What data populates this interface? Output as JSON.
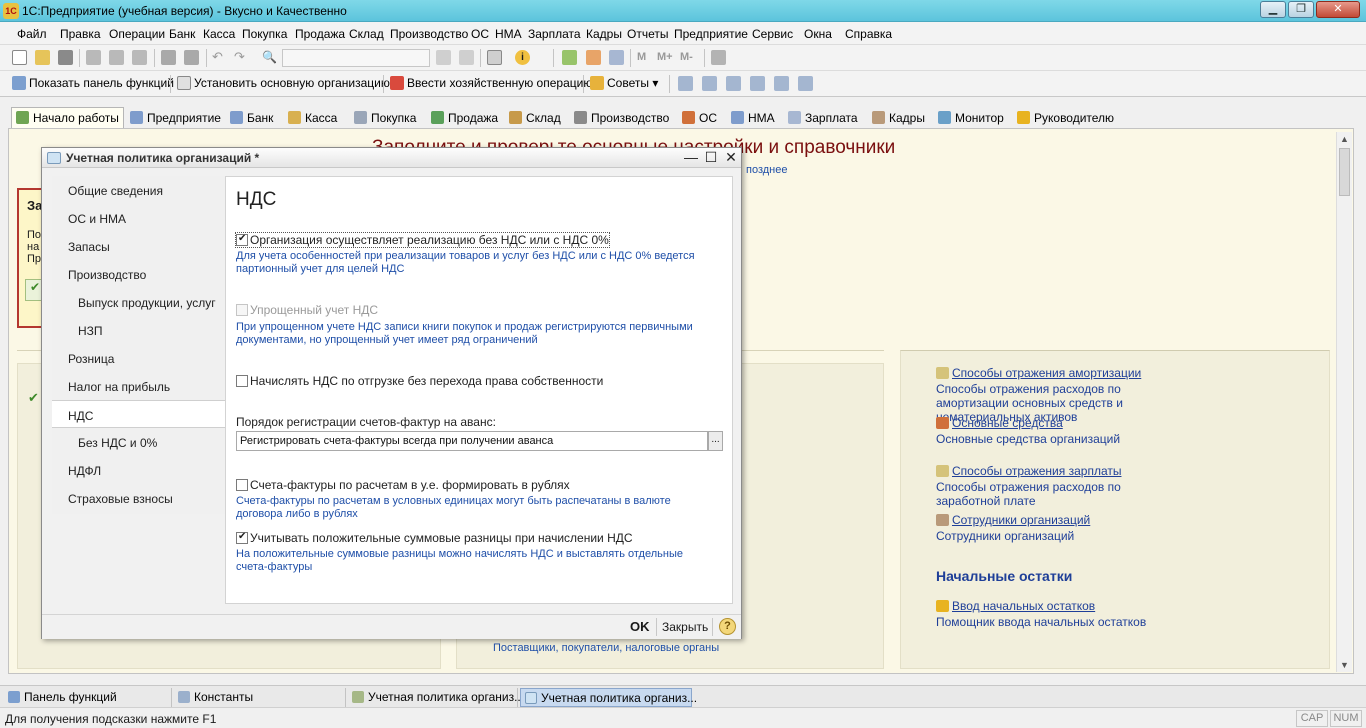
{
  "window": {
    "title": "1С:Предприятие (учебная версия) - Вкусно и Качественно",
    "logo": "1C"
  },
  "menu": [
    "Файл",
    "Правка",
    "Операции",
    "Банк",
    "Касса",
    "Покупка",
    "Продажа",
    "Склад",
    "Производство",
    "ОС",
    "НМА",
    "Зарплата",
    "Кадры",
    "Отчеты",
    "Предприятие",
    "Сервис",
    "Окна",
    "Справка"
  ],
  "toolbar2": {
    "show_panel": "Показать панель функций",
    "set_org": "Установить основную организацию",
    "enter_op": "Ввести хозяйственную операцию",
    "tips": "Советы"
  },
  "tabs": [
    "Начало работы",
    "Предприятие",
    "Банк",
    "Касса",
    "Покупка",
    "Продажа",
    "Склад",
    "Производство",
    "ОС",
    "НМА",
    "Зарплата",
    "Кадры",
    "Монитор",
    "Руководителю"
  ],
  "main": {
    "headline": "Заполните и проверьте основные настройки и справочники",
    "later_link": "позднее",
    "left_box_lines": [
      "За",
      "По",
      "на",
      "Пр"
    ],
    "right_links": [
      {
        "title": "Способы отражения амортизации",
        "desc": "Способы отражения расходов по амортизации основных средств и нематериальных активов"
      },
      {
        "title": "Основные средства",
        "desc": "Основные средства организаций"
      },
      {
        "title": "Способы отражения зарплаты",
        "desc": "Способы отражения расходов по заработной плате"
      },
      {
        "title": "Сотрудники организаций",
        "desc": "Сотрудники организаций"
      }
    ],
    "section_title": "Начальные остатки",
    "opening_link": {
      "title": "Ввод начальных остатков",
      "desc": "Помощник ввода начальных остатков"
    },
    "bottom_text": "Поставщики, покупатели, налоговые органы"
  },
  "dialog": {
    "title": "Учетная политика организаций *",
    "nav": [
      "Общие сведения",
      "ОС и НМА",
      "Запасы",
      "Производство",
      "Выпуск продукции, услуг",
      "НЗП",
      "Розница",
      "Налог на прибыль",
      "НДС",
      "Без НДС и 0%",
      "НДФЛ",
      "Страховые взносы"
    ],
    "selected": "НДС",
    "heading": "НДС",
    "opt1": {
      "label": "Организация осуществляет реализацию без НДС или с НДС 0%",
      "desc": "Для учета особенностей при реализации товаров и услуг без НДС или с НДС 0% ведется партионный учет для целей НДС",
      "checked": true
    },
    "opt2": {
      "label": "Упрощенный учет НДС",
      "desc": "При упрощенном учете НДС записи книги покупок и продаж регистрируются первичными документами, но упрощенный учет имеет ряд ограничений",
      "checked": false
    },
    "opt3": {
      "label": "Начислять НДС по отгрузке без перехода права собственности",
      "checked": false
    },
    "invoice_label": "Порядок регистрации счетов-фактур на аванс:",
    "invoice_value": "Регистрировать счета-фактуры всегда при получении аванса",
    "opt4": {
      "label": "Счета-фактуры по расчетам в у.е. формировать в рублях",
      "desc": "Счета-фактуры по расчетам в условных единицах могут быть распечатаны в валюте договора либо в рублях",
      "checked": false
    },
    "opt5": {
      "label": "Учитывать положительные суммовые разницы при начислении НДС",
      "desc": "На положительные суммовые разницы можно начислять НДС и выставлять отдельные счета-фактуры",
      "checked": true
    },
    "ok": "OK",
    "close": "Закрыть"
  },
  "taskbar": [
    "Панель функций",
    "Константы",
    "Учетная политика организ...",
    "Учетная политика организ..."
  ],
  "status": {
    "hint": "Для получения подсказки нажмите F1",
    "cap": "CAP",
    "num": "NUM"
  }
}
